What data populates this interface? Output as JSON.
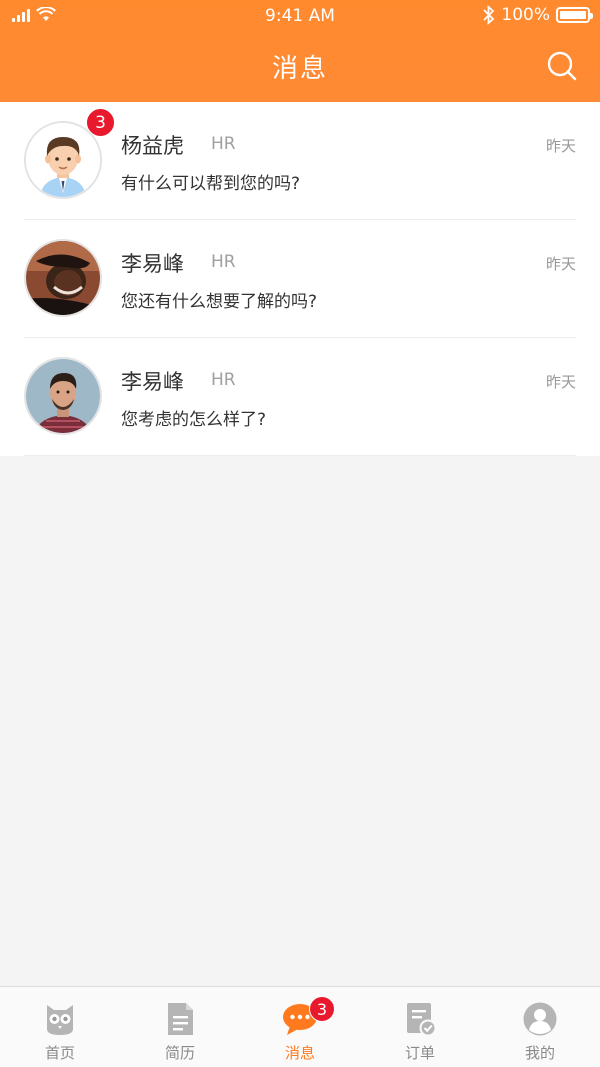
{
  "status_bar": {
    "time": "9:41 AM",
    "battery": "100%"
  },
  "header": {
    "title": "消息"
  },
  "conversations": [
    {
      "name": "杨益虎",
      "role": "HR",
      "time": "昨天",
      "message": "有什么可以帮到您的吗?",
      "unread": "3",
      "avatar": "cartoon-man-avatar"
    },
    {
      "name": "李易峰",
      "role": "HR",
      "time": "昨天",
      "message": "您还有什么想要了解的吗?",
      "avatar": "woman-photo-avatar"
    },
    {
      "name": "李易峰",
      "role": "HR",
      "time": "昨天",
      "message": "您考虑的怎么样了?",
      "avatar": "man-photo-avatar"
    }
  ],
  "tabbar": {
    "items": [
      {
        "label": "首页",
        "icon": "owl-icon"
      },
      {
        "label": "简历",
        "icon": "document-icon"
      },
      {
        "label": "消息",
        "icon": "chat-bubble-icon",
        "badge": "3",
        "active": true
      },
      {
        "label": "订单",
        "icon": "order-check-icon"
      },
      {
        "label": "我的",
        "icon": "user-icon"
      }
    ]
  },
  "colors": {
    "accent": "#ff8a2e",
    "badge": "#e8192c",
    "active_tab": "#ff7a1f"
  }
}
